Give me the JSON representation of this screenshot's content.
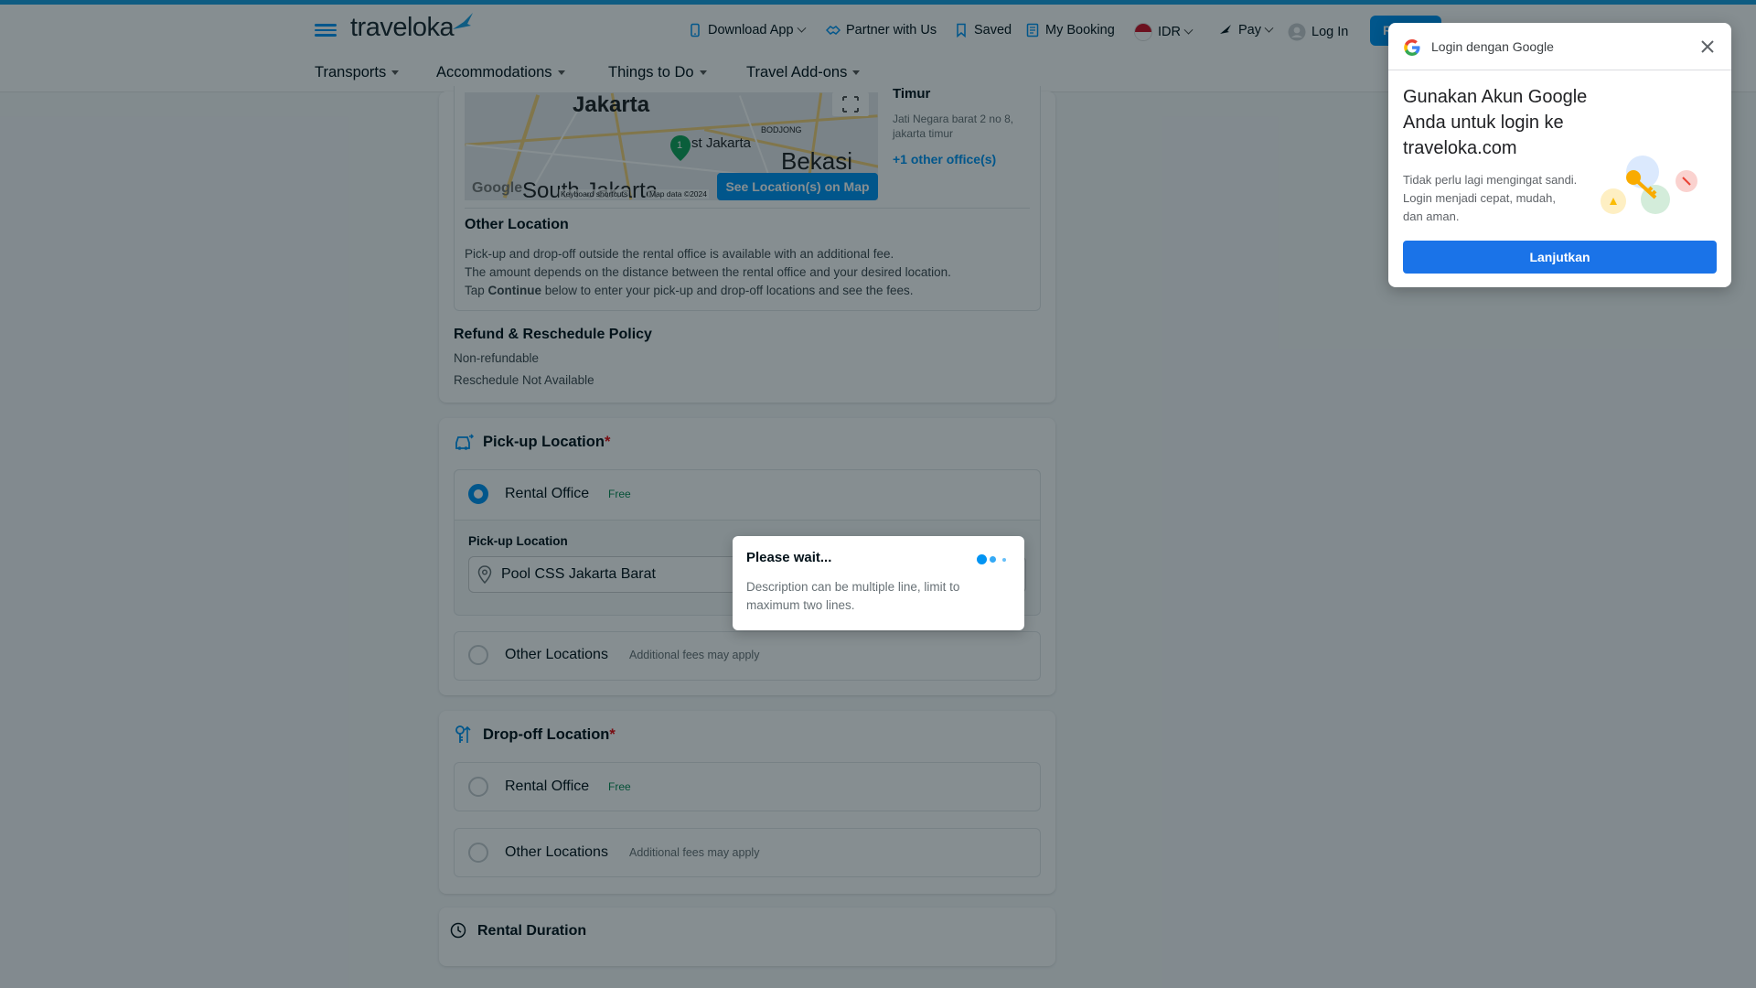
{
  "header": {
    "logo": "traveloka",
    "nav": {
      "download_app": "Download App",
      "partner": "Partner with Us",
      "saved": "Saved",
      "my_booking": "My Booking",
      "currency": "IDR",
      "pay": "Pay",
      "login": "Log In",
      "register": "R..."
    }
  },
  "subnav": {
    "transports": "Transports",
    "accommodations": "Accommodations",
    "things_to_do": "Things to Do",
    "travel_addons": "Travel Add-ons"
  },
  "office": {
    "title_fragment": "Timur",
    "address": "Jati Negara barat 2 no 8, jakarta timur",
    "other_offices_link": "+1 other office(s)",
    "map_button": "See Location(s) on Map",
    "map_labels": {
      "city1": "Jakarta",
      "city2": "Bekasi",
      "city3": "st Jakarta",
      "city4": "South Jakarta",
      "district": "BODJONG",
      "google": "Google",
      "shortcuts": "Keyboard shortcuts",
      "mapdata": "Map data ©2024",
      "pin": "1"
    }
  },
  "other_location": {
    "heading": "Other Location",
    "line1": "Pick-up and drop-off outside the rental office is available with an additional fee.",
    "line2": "The amount depends on the distance between the rental office and your desired location.",
    "line3_pre": "Tap ",
    "line3_bold": "Continue",
    "line3_post": " below to enter your pick-up and drop-off locations and see the fees."
  },
  "policy": {
    "heading": "Refund & Reschedule Policy",
    "refund": "Non-refundable",
    "reschedule": "Reschedule Not Available"
  },
  "pickup": {
    "heading": "Pick-up Location",
    "required_mark": "*",
    "rental_office": "Rental Office",
    "free": "Free",
    "field_label": "Pick-up Location",
    "field_value": "Pool CSS Jakarta Barat",
    "other_locations": "Other Locations",
    "additional_fee": "Additional fees may apply"
  },
  "dropoff": {
    "heading": "Drop-off Location",
    "required_mark": "*",
    "rental_office": "Rental Office",
    "free": "Free",
    "other_locations": "Other Locations",
    "additional_fee": "Additional fees may apply"
  },
  "duration": {
    "heading": "Rental Duration"
  },
  "wait_dialog": {
    "title": "Please wait...",
    "description": "Description can be multiple line, limit to maximum two lines."
  },
  "google_popup": {
    "header": "Login dengan Google",
    "title_line1": "Gunakan Akun Google",
    "title_line2": "Anda untuk login ke",
    "title_line3": "traveloka.com",
    "body_line1": "Tidak perlu lagi mengingat sandi.",
    "body_line2": "Login menjadi cepat, mudah,",
    "body_line3": "dan aman.",
    "button": "Lanjutkan"
  },
  "colors": {
    "brand_blue": "#0194f3",
    "overlay": "rgba(3,18,26,0.48)",
    "required_red": "#e7090e",
    "free_green": "#0a8a55",
    "google_blue": "#1a73e8"
  }
}
